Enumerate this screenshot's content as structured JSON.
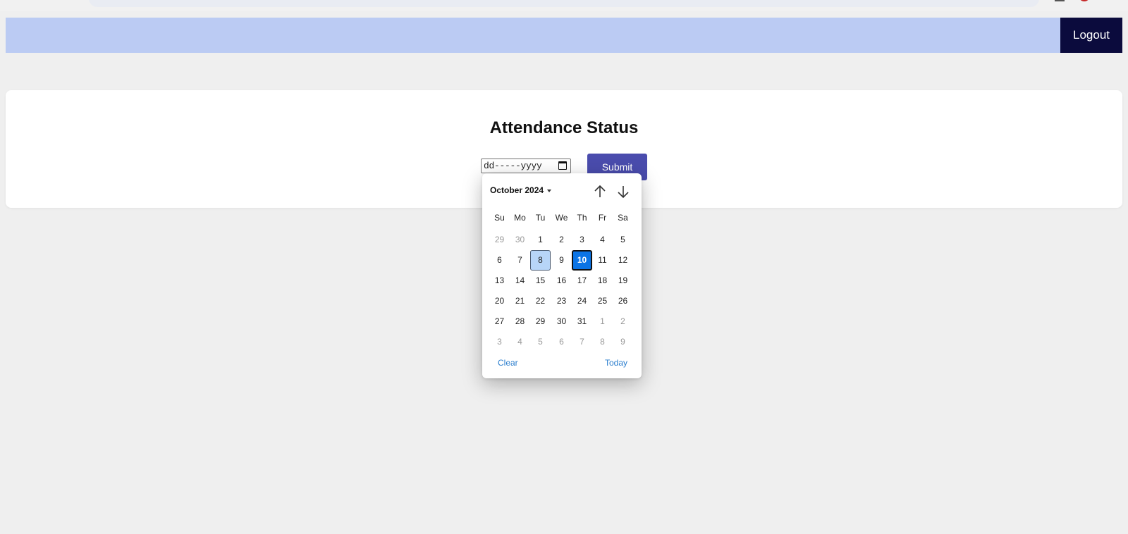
{
  "navbar": {
    "logout_label": "Logout",
    "color": "#bbcbf3"
  },
  "page": {
    "title": "Attendance Status"
  },
  "form": {
    "date_placeholder": "dd-----yyyy",
    "submit_label": "Submit"
  },
  "datepicker": {
    "month_label": "October 2024",
    "weekdays": [
      "Su",
      "Mo",
      "Tu",
      "We",
      "Th",
      "Fr",
      "Sa"
    ],
    "weeks": [
      [
        {
          "d": "29",
          "other": true
        },
        {
          "d": "30",
          "other": true
        },
        {
          "d": "1"
        },
        {
          "d": "2"
        },
        {
          "d": "3"
        },
        {
          "d": "4"
        },
        {
          "d": "5"
        }
      ],
      [
        {
          "d": "6"
        },
        {
          "d": "7"
        },
        {
          "d": "8",
          "state": "focused"
        },
        {
          "d": "9"
        },
        {
          "d": "10",
          "state": "selected"
        },
        {
          "d": "11"
        },
        {
          "d": "12"
        }
      ],
      [
        {
          "d": "13"
        },
        {
          "d": "14"
        },
        {
          "d": "15"
        },
        {
          "d": "16"
        },
        {
          "d": "17"
        },
        {
          "d": "18"
        },
        {
          "d": "19"
        }
      ],
      [
        {
          "d": "20"
        },
        {
          "d": "21"
        },
        {
          "d": "22"
        },
        {
          "d": "23"
        },
        {
          "d": "24"
        },
        {
          "d": "25"
        },
        {
          "d": "26"
        }
      ],
      [
        {
          "d": "27"
        },
        {
          "d": "28"
        },
        {
          "d": "29"
        },
        {
          "d": "30"
        },
        {
          "d": "31"
        },
        {
          "d": "1",
          "other": true
        },
        {
          "d": "2",
          "other": true
        }
      ],
      [
        {
          "d": "3",
          "other": true
        },
        {
          "d": "4",
          "other": true
        },
        {
          "d": "5",
          "other": true
        },
        {
          "d": "6",
          "other": true
        },
        {
          "d": "7",
          "other": true
        },
        {
          "d": "8",
          "other": true
        },
        {
          "d": "9",
          "other": true
        }
      ]
    ],
    "clear_label": "Clear",
    "today_label": "Today",
    "accent_color": "#0b74e5",
    "link_color": "#2c7fce"
  }
}
